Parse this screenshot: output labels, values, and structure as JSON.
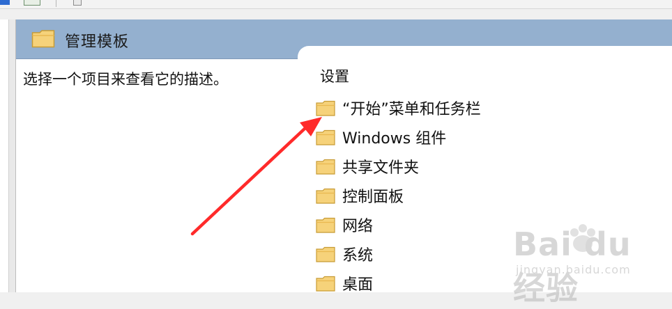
{
  "header": {
    "title": "管理模板",
    "icon": "folder-icon"
  },
  "details": {
    "description": "选择一个项目来查看它的描述。"
  },
  "list": {
    "column_header": "设置",
    "items": [
      {
        "label": "“开始”菜单和任务栏",
        "icon": "folder-icon"
      },
      {
        "label": "Windows 组件",
        "icon": "folder-icon"
      },
      {
        "label": "共享文件夹",
        "icon": "folder-icon"
      },
      {
        "label": "控制面板",
        "icon": "folder-icon"
      },
      {
        "label": "网络",
        "icon": "folder-icon"
      },
      {
        "label": "系统",
        "icon": "folder-icon"
      },
      {
        "label": "桌面",
        "icon": "folder-icon"
      }
    ]
  },
  "annotation": {
    "arrow_color": "#ff2a2a",
    "arrow_icon": "arrow-icon"
  },
  "watermark": {
    "brand": "Bai du 经验",
    "url": "jingyan.baidu.com",
    "icon": "paw-icon"
  },
  "colors": {
    "header_band": "#94b0cf",
    "folder_fill": "#f6d27a",
    "folder_stroke": "#c79b35"
  }
}
